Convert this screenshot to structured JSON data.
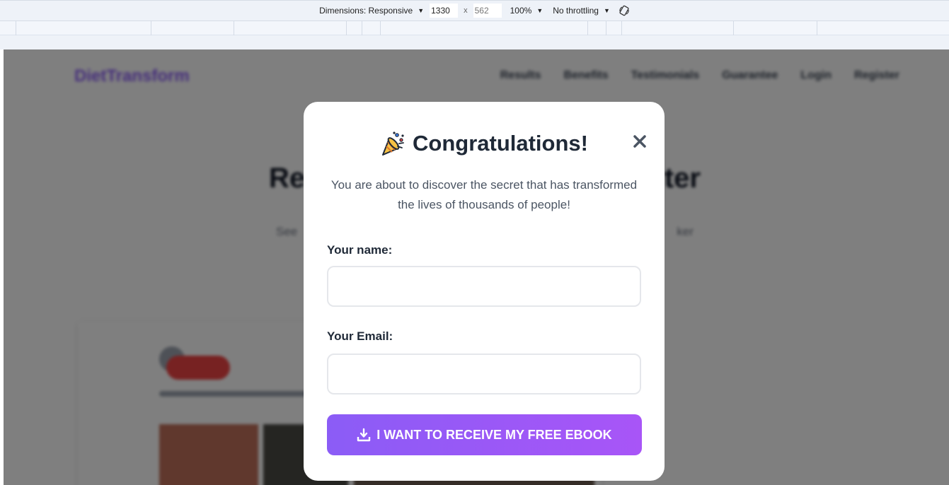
{
  "devtools": {
    "dimensions_label": "Dimensions: Responsive",
    "width_value": "1330",
    "height_value": "562",
    "times": "x",
    "zoom": "100%",
    "throttling": "No throttling"
  },
  "site": {
    "logo": "DietTransform",
    "nav": [
      "Results",
      "Benefits",
      "Testimonials",
      "Guarantee",
      "Login",
      "Register"
    ],
    "hero_title_left": "Re",
    "hero_title_right": "ter",
    "hero_sub_left": "See",
    "hero_sub_right": "ker"
  },
  "modal": {
    "title": "Congratulations!",
    "close_symbol": "×",
    "description": "You are about to discover the secret that has transformed the lives of thousands of people!",
    "name_label": "Your name:",
    "name_value": "",
    "email_label": "Your Email:",
    "email_value": "",
    "submit_label": "I WANT TO RECEIVE MY FREE EBOOK"
  },
  "colors": {
    "accent": "#8b5cf6",
    "accent_end": "#a855f7",
    "overlay": "rgba(0,0,0,0.5)"
  },
  "icons": [
    "party-popper-icon",
    "close-icon",
    "download-icon",
    "rotate-icon"
  ]
}
